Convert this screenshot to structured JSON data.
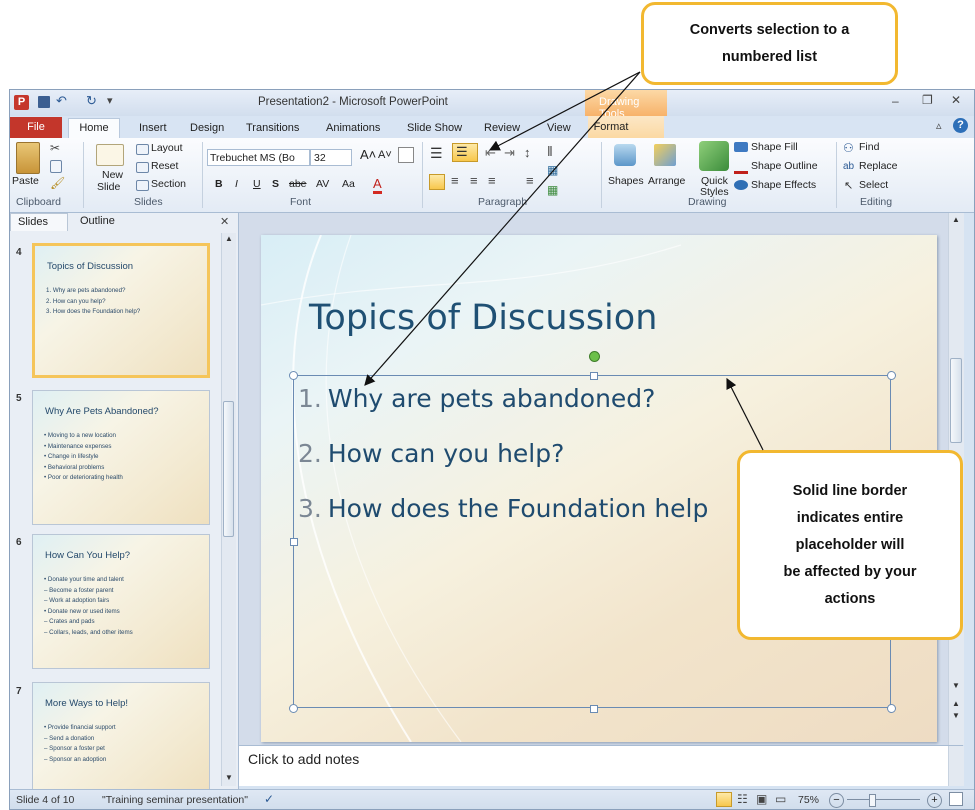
{
  "callouts": {
    "numbering": [
      "Converts selection to a",
      "numbered list"
    ],
    "border": [
      "Solid line border",
      "indicates entire",
      "placeholder will",
      "be affected by your",
      "actions"
    ]
  },
  "window": {
    "title": "Presentation2 - Microsoft PowerPoint",
    "contextual_tab": "Drawing Tools"
  },
  "tabs": [
    "File",
    "Home",
    "Insert",
    "Design",
    "Transitions",
    "Animations",
    "Slide Show",
    "Review",
    "View",
    "Format"
  ],
  "ribbon": {
    "clipboard": {
      "paste": "Paste",
      "label": "Clipboard"
    },
    "slides": {
      "new_slide": "New",
      "new_slide2": "Slide",
      "layout": "Layout",
      "reset": "Reset",
      "section": "Section",
      "label": "Slides"
    },
    "font": {
      "font_name": "Trebuchet MS (Bo",
      "font_size": "32",
      "label": "Font"
    },
    "paragraph": {
      "label": "Paragraph"
    },
    "drawing": {
      "shapes": "Shapes",
      "arrange": "Arrange",
      "quick": "Quick",
      "styles": "Styles",
      "fill": "Shape Fill",
      "outline": "Shape Outline",
      "effects": "Shape Effects",
      "label": "Drawing"
    },
    "editing": {
      "find": "Find",
      "replace": "Replace",
      "select": "Select",
      "label": "Editing"
    }
  },
  "panel": {
    "tab_slides": "Slides",
    "tab_outline": "Outline"
  },
  "thumbnails": [
    {
      "num": "4",
      "title": "Topics of Discussion",
      "lines": [
        "1.  Why are pets abandoned?",
        "2.  How can you help?",
        "3.  How does the Foundation  help?"
      ]
    },
    {
      "num": "5",
      "title": "Why Are Pets Abandoned?",
      "lines": [
        "• Moving to a new location",
        "• Maintenance  expenses",
        "• Change  in lifestyle",
        "• Behavioral  problems",
        "• Poor or deteriorating  health"
      ]
    },
    {
      "num": "6",
      "title": "How Can You Help?",
      "lines": [
        "• Donate your time and talent",
        "   – Become a foster parent",
        "   – Work at adoption fairs",
        "• Donate new or used items",
        "   – Crates and pads",
        "   – Collars, leads, and other items"
      ]
    },
    {
      "num": "7",
      "title": "More Ways to Help!",
      "lines": [
        "• Provide  financial  support",
        "   – Send a donation",
        "   – Sponsor a foster pet",
        "   – Sponsor an adoption"
      ]
    }
  ],
  "slide": {
    "title": "Topics of Discussion",
    "items": [
      {
        "num": "1.",
        "text": "Why are pets abandoned?"
      },
      {
        "num": "2.",
        "text": "How can you help?"
      },
      {
        "num": "3.",
        "text": "How does the Foundation help"
      }
    ]
  },
  "notes_placeholder": "Click to add notes",
  "status": {
    "slide": "Slide 4 of 10",
    "theme": "\"Training seminar presentation\"",
    "zoom": "75%"
  },
  "colors": {
    "accent": "#f2b830",
    "file_tab": "#c3362b",
    "title_text": "#1f5074"
  }
}
